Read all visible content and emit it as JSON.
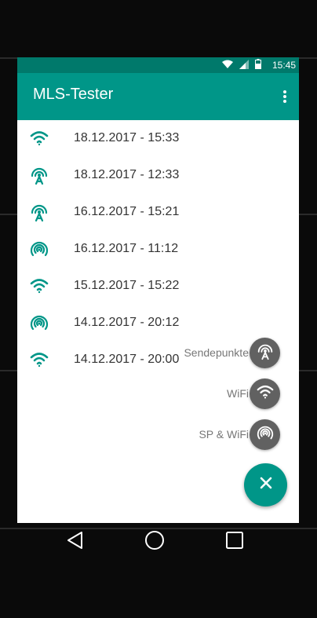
{
  "status_bar": {
    "time": "15:45",
    "icons": [
      "wifi-icon",
      "signal-icon",
      "battery-icon"
    ]
  },
  "app_bar": {
    "title": "MLS-Tester",
    "overflow_icon": "more-vert-icon"
  },
  "list": {
    "items": [
      {
        "icon": "wifi-icon",
        "label": "18.12.2017 - 15:33"
      },
      {
        "icon": "tower-icon",
        "label": "18.12.2017 - 12:33"
      },
      {
        "icon": "tower-icon",
        "label": "16.12.2017 - 15:21"
      },
      {
        "icon": "sp-wifi-icon",
        "label": "16.12.2017 - 11:12"
      },
      {
        "icon": "wifi-icon",
        "label": "15.12.2017 - 15:22"
      },
      {
        "icon": "sp-wifi-icon",
        "label": "14.12.2017 - 20:12"
      },
      {
        "icon": "wifi-icon",
        "label": "14.12.2017 - 20:00"
      }
    ]
  },
  "fab_menu": {
    "items": [
      {
        "label": "Sendepunkte",
        "icon": "tower-icon"
      },
      {
        "label": "WiFi",
        "icon": "wifi-icon"
      },
      {
        "label": "SP & WiFi",
        "icon": "sp-wifi-icon"
      }
    ],
    "main_icon": "close-icon"
  },
  "nav_bar": {
    "buttons": [
      "back-icon",
      "home-icon",
      "recents-icon"
    ]
  },
  "colors": {
    "primary": "#009688",
    "primary_dark": "#00796b",
    "fab_mini": "#616161",
    "text": "#333333"
  }
}
